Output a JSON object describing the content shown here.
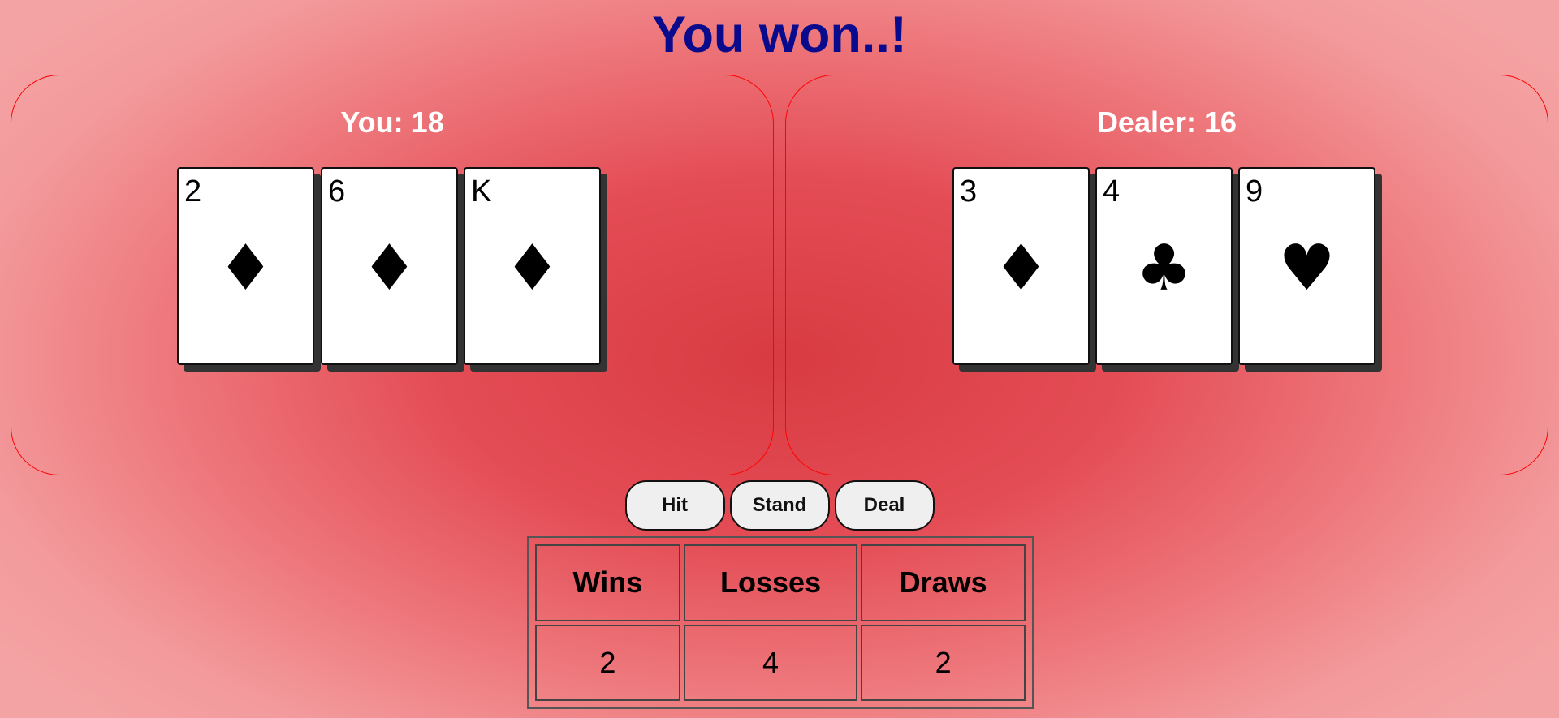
{
  "result": "You won..!",
  "player": {
    "label": "You:",
    "score": "18",
    "cards": [
      {
        "rank": "2",
        "suit": "♦",
        "suit_name": "diamond-icon"
      },
      {
        "rank": "6",
        "suit": "♦",
        "suit_name": "diamond-icon"
      },
      {
        "rank": "K",
        "suit": "♦",
        "suit_name": "diamond-icon"
      }
    ]
  },
  "dealer": {
    "label": "Dealer:",
    "score": "16",
    "cards": [
      {
        "rank": "3",
        "suit": "♦",
        "suit_name": "diamond-icon"
      },
      {
        "rank": "4",
        "suit": "♣",
        "suit_name": "club-icon"
      },
      {
        "rank": "9",
        "suit": "♥",
        "suit_name": "heart-icon"
      }
    ]
  },
  "controls": {
    "hit": "Hit",
    "stand": "Stand",
    "deal": "Deal"
  },
  "scoreboard": {
    "headers": [
      "Wins",
      "Losses",
      "Draws"
    ],
    "values": [
      "2",
      "4",
      "2"
    ]
  },
  "colors": {
    "title": "#0a0a8c",
    "panel_border": "#ff0000",
    "table_center": "#d83b42",
    "table_edge": "#f4a3a4"
  }
}
